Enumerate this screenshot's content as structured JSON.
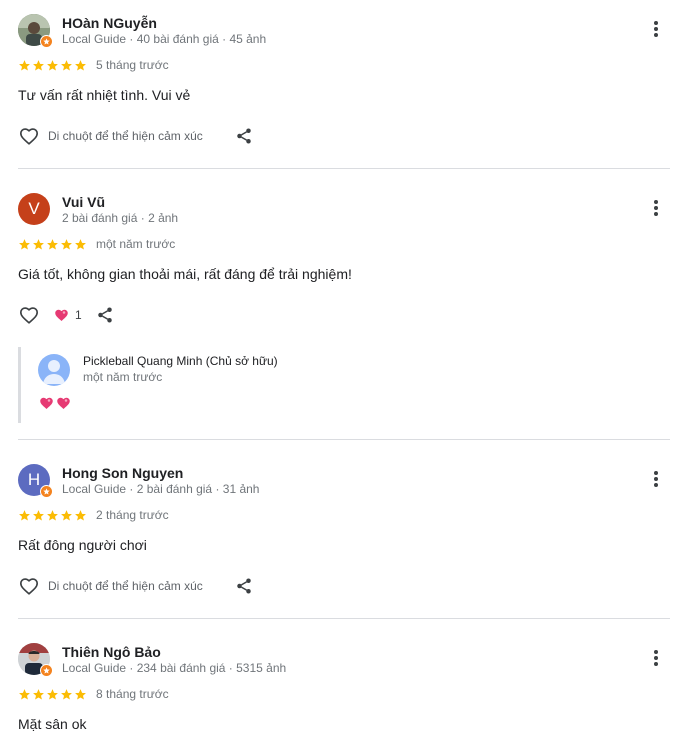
{
  "colors": {
    "star": "#fbbc04",
    "badge": "#f4831f",
    "divider": "#dadce0",
    "heart_reaction": "#e63a73"
  },
  "icons": {
    "star": "star-icon",
    "more": "more-vert-icon",
    "like": "heart-outline-icon",
    "share": "share-icon",
    "reaction": "heart-emoji-icon",
    "badge": "local-guide-badge-icon"
  },
  "reviews": [
    {
      "name": "HOàn NGuyễn",
      "meta": "Local Guide · 40 bài đánh giá · 45 ảnh",
      "rating": 5,
      "when": "5 tháng trước",
      "text": "Tư vấn rất nhiệt tình. Vui vẻ",
      "hover_hint": "Di chuột để thể hiện cảm xúc"
    },
    {
      "name": "Vui Vũ",
      "avatar_letter": "V",
      "avatar_color": "#c5401a",
      "meta": "2 bài đánh giá · 2 ảnh",
      "rating": 5,
      "when": "một năm trước",
      "text": "Giá tốt, không gian thoải mái, rất đáng để trải nghiệm!",
      "reaction_count": "1",
      "owner_reply": {
        "name": "Pickleball Quang Minh (Chủ sở hữu)",
        "when": "một năm trước",
        "hearts": 2
      }
    },
    {
      "name": "Hong Son Nguyen",
      "avatar_letter": "H",
      "avatar_color": "#5c6bc0",
      "meta": "Local Guide · 2 bài đánh giá · 31 ảnh",
      "rating": 5,
      "when": "2 tháng trước",
      "text": "Rất đông người chơi",
      "hover_hint": "Di chuột để thể hiện cảm xúc"
    },
    {
      "name": "Thiên Ngô Bảo",
      "meta": "Local Guide · 234 bài đánh giá · 5315 ảnh",
      "rating": 5,
      "when": "8 tháng trước",
      "text": "Mặt sân ok"
    }
  ]
}
